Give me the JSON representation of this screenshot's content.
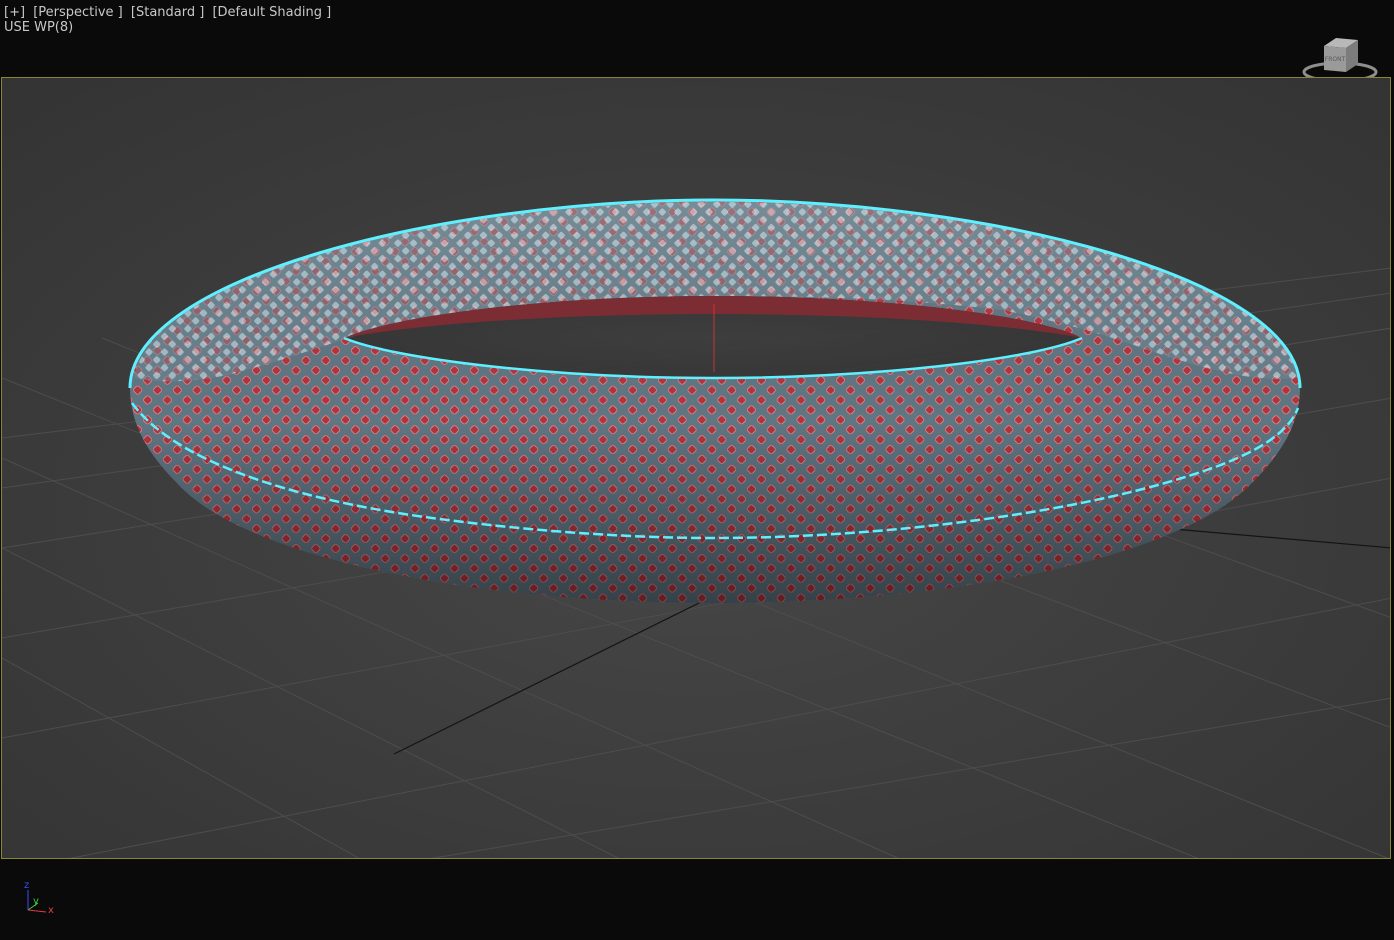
{
  "viewport": {
    "menus": [
      "[+]",
      "[Perspective ]",
      "[Standard ]",
      "[Default Shading ]"
    ],
    "info": "USE WP(8)"
  },
  "viewcube": {
    "face_label": "FRONT"
  },
  "axis": {
    "z": "z",
    "y": "y",
    "x": "x"
  },
  "colors": {
    "background": "#0a0a0a",
    "viewport": "#3b3b3b",
    "safe_frame": "#8a8530",
    "selection": "#5ff0ff",
    "lattice": "#5f7683",
    "inner_core": "#b3333d"
  },
  "scene": {
    "object": "lattice-torus",
    "selected": true
  }
}
